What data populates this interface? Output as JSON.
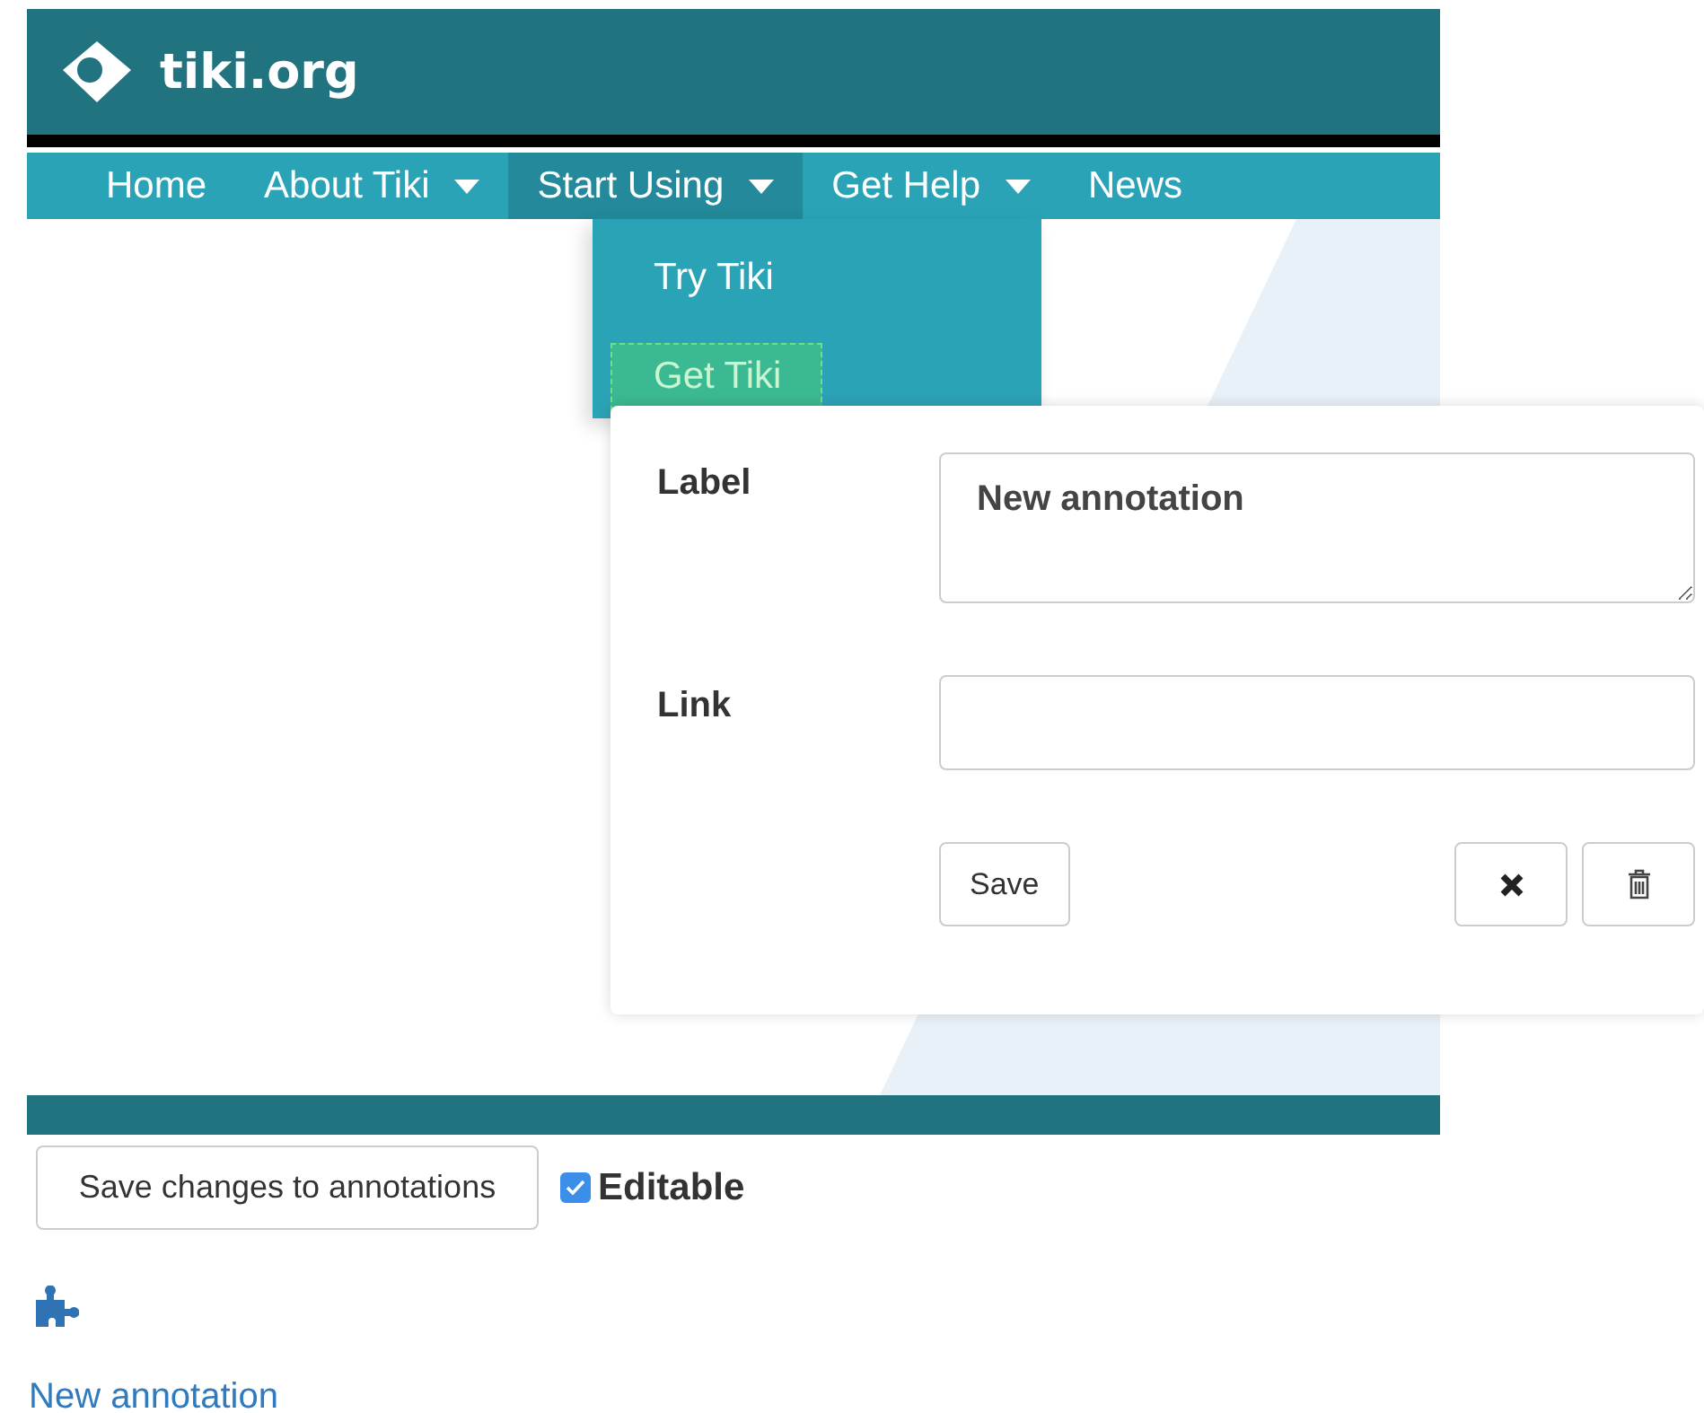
{
  "site": {
    "title": "tiki.org"
  },
  "nav": [
    {
      "label": "Home",
      "has_menu": false,
      "selected": false
    },
    {
      "label": "About Tiki",
      "has_menu": true,
      "selected": false
    },
    {
      "label": "Start Using",
      "has_menu": true,
      "selected": true
    },
    {
      "label": "Get Help",
      "has_menu": true,
      "selected": false
    },
    {
      "label": "News",
      "has_menu": false,
      "selected": false
    }
  ],
  "dropdown": [
    {
      "label": "Try Tiki",
      "selected": false
    },
    {
      "label": "Get Tiki",
      "selected": true
    }
  ],
  "annotation_form": {
    "label_caption": "Label",
    "label_value": "New annotation",
    "link_caption": "Link",
    "save_button": "Save"
  },
  "save_changes_button": "Save changes to annotations",
  "editable": {
    "label": "Editable",
    "checked": true
  },
  "new_annotation_link": "New annotation"
}
